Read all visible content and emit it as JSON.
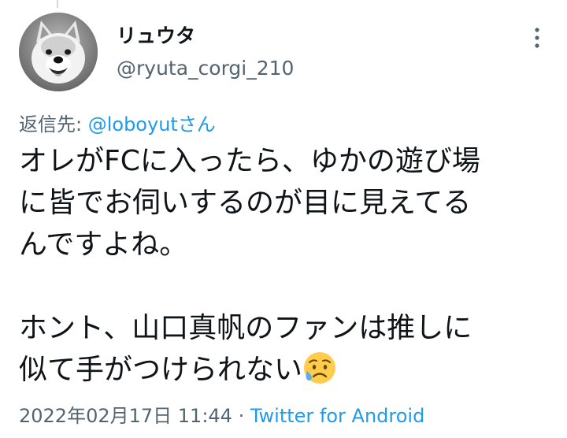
{
  "tweet": {
    "author": {
      "display_name": "リュウタ",
      "handle": "@ryuta_corgi_210"
    },
    "reply_to": {
      "prefix": "返信先: ",
      "mention": "@loboyut",
      "suffix": "さん"
    },
    "text": "オレがFCに入ったら、ゆかの遊び場\nに皆でお伺いするのが目に見えてる\nんですよね。\n\nホント、山口真帆のファンは推しに\n似て手がつけられない",
    "emoji": "sad-but-relieved-face",
    "timestamp": "2022年02月17日 11:44",
    "separator": " · ",
    "source": "Twitter for Android",
    "icons": {
      "more": "more-vertical-icon"
    },
    "colors": {
      "link": "#1d9bf0",
      "secondary_text": "#536471",
      "primary_text": "#0f1419"
    }
  }
}
